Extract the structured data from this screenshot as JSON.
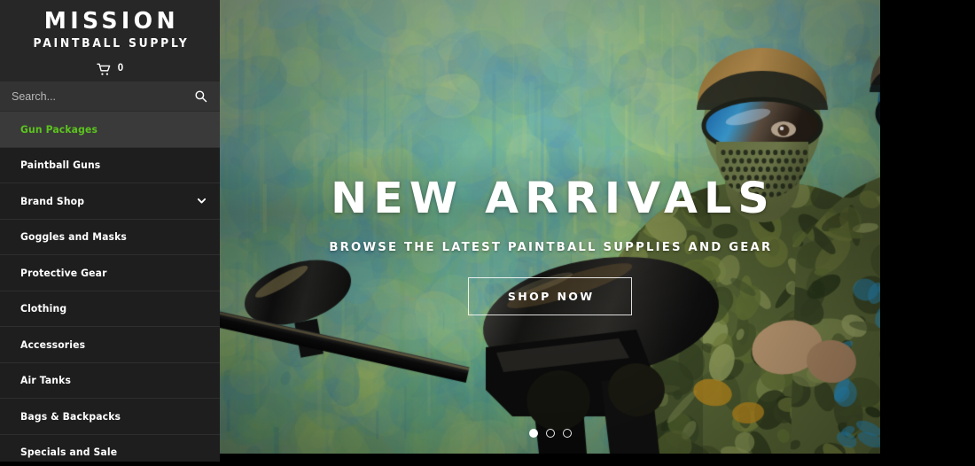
{
  "brand": {
    "line1": "MISSION",
    "line2": "PAINTBALL SUPPLY"
  },
  "cart": {
    "icon": "shopping-cart-icon",
    "count": "0"
  },
  "search": {
    "placeholder": "Search...",
    "value": "",
    "icon": "search-icon"
  },
  "sidebar": {
    "items": [
      {
        "label": "Gun Packages",
        "active": true,
        "expandable": false
      },
      {
        "label": "Paintball Guns",
        "active": false,
        "expandable": false
      },
      {
        "label": "Brand Shop",
        "active": false,
        "expandable": true,
        "icon": "chevron-down-icon"
      },
      {
        "label": "Goggles and Masks",
        "active": false,
        "expandable": false
      },
      {
        "label": "Protective Gear",
        "active": false,
        "expandable": false
      },
      {
        "label": "Clothing",
        "active": false,
        "expandable": false
      },
      {
        "label": "Accessories",
        "active": false,
        "expandable": false
      },
      {
        "label": "Air Tanks",
        "active": false,
        "expandable": false
      },
      {
        "label": "Bags & Backpacks",
        "active": false,
        "expandable": false
      },
      {
        "label": "Specials and Sale",
        "active": false,
        "expandable": false
      }
    ]
  },
  "hero": {
    "title": "NEW ARRIVALS",
    "subtitle": "BROWSE THE LATEST PAINTBALL SUPPLIES AND GEAR",
    "cta_label": "SHOP NOW",
    "slides": [
      {
        "active": true
      },
      {
        "active": false
      },
      {
        "active": false
      }
    ],
    "image_description": "Two paintball players in camouflage wearing masks with mirrored goggles, holding a black paintball marker with hopper, in front of a paint-splattered green and teal wall"
  },
  "colors": {
    "accent_green": "#5cc31f",
    "sidebar_bg": "#1e1e1e",
    "sidebar_active_bg": "#3a3a3a",
    "search_bg": "#333333",
    "brand_bg": "#272727",
    "page_bg": "#000000",
    "text": "#ffffff"
  }
}
